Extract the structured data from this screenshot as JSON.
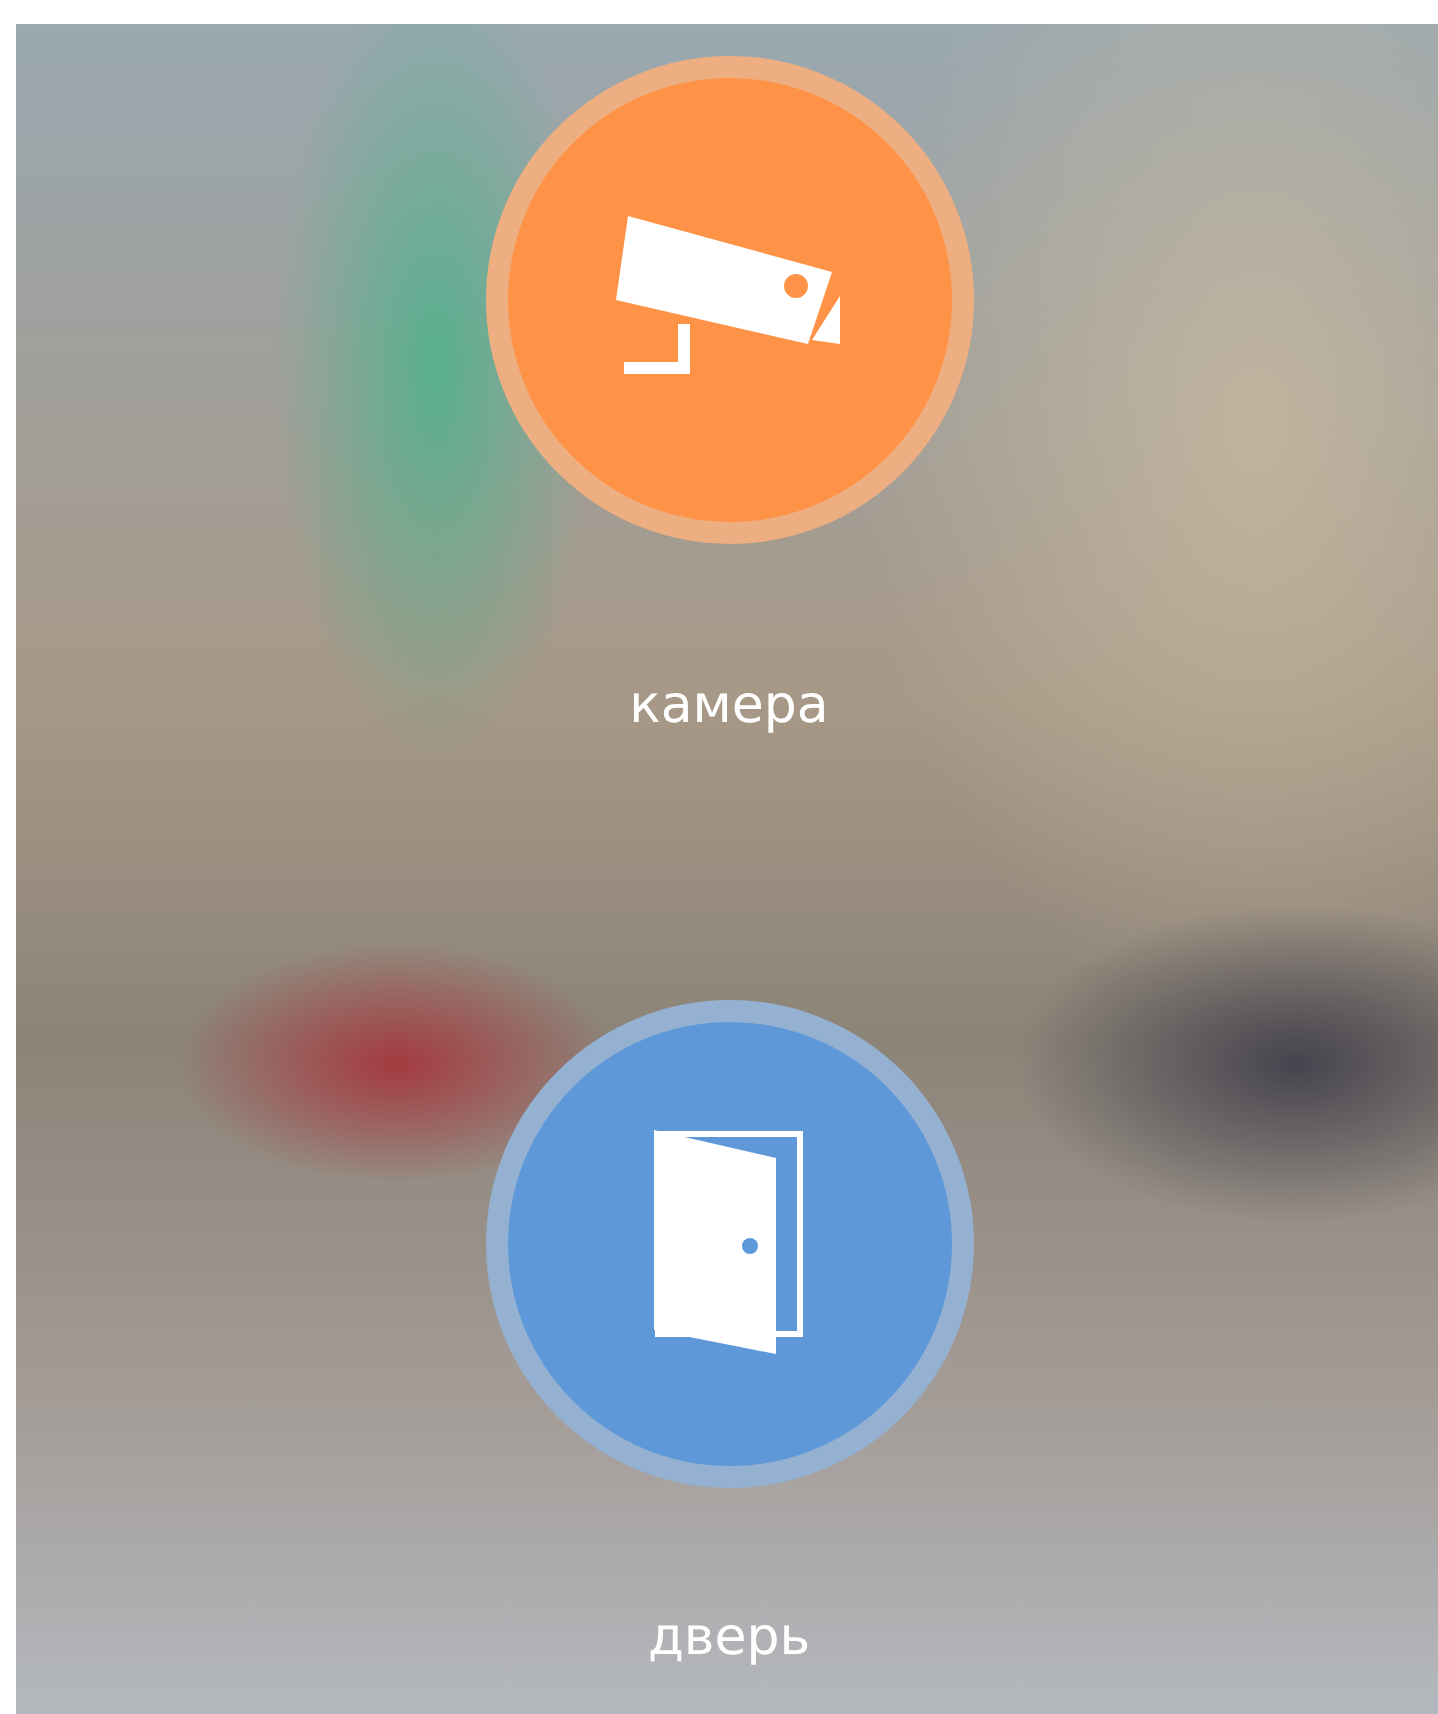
{
  "actions": [
    {
      "kind": "camera",
      "label": "камера",
      "color": "#fe9347"
    },
    {
      "kind": "door",
      "label": "дверь",
      "color": "#5e98d8"
    }
  ]
}
